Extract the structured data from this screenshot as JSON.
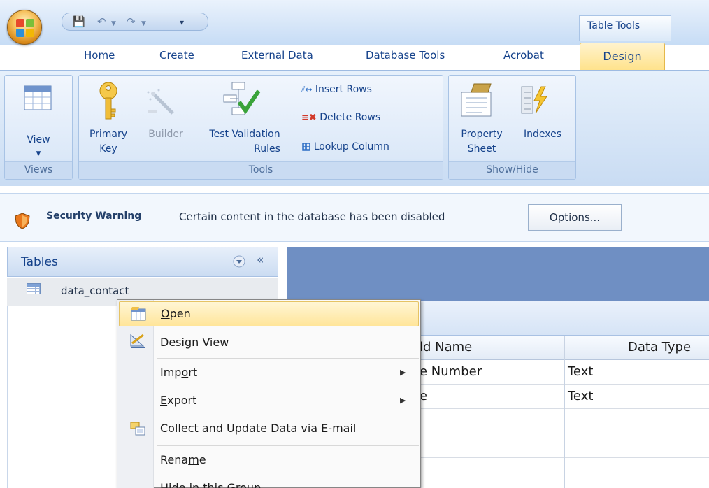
{
  "window": {
    "context_tab_group": "Table Tools"
  },
  "tabs": [
    "Home",
    "Create",
    "External Data",
    "Database Tools",
    "Acrobat"
  ],
  "active_tab": "Design",
  "ribbon": {
    "views": {
      "title": "Views",
      "view_label": "View"
    },
    "tools": {
      "title": "Tools",
      "primary_key_1": "Primary",
      "primary_key_2": "Key",
      "builder": "Builder",
      "test_validation_1": "Test Validation",
      "test_validation_2": "Rules",
      "insert_rows": "Insert Rows",
      "delete_rows": "Delete Rows",
      "lookup_column": "Lookup Column"
    },
    "show_hide": {
      "title": "Show/Hide",
      "property_sheet_1": "Property",
      "property_sheet_2": "Sheet",
      "indexes": "Indexes"
    }
  },
  "security": {
    "title": "Security Warning",
    "message": "Certain content in the database has been disabled",
    "options": "Options..."
  },
  "nav": {
    "header": "Tables",
    "collapse_glyph": "«",
    "item": "data_contact"
  },
  "design_grid": {
    "headers": [
      "ld Name",
      "Data Type"
    ],
    "rows": [
      [
        "e Number",
        "Text"
      ],
      [
        "e",
        "Text"
      ]
    ]
  },
  "context_menu": {
    "items": {
      "open_key": "O",
      "open_rest": "pen",
      "design_key": "D",
      "design_rest": "esign View",
      "import_pre": "Imp",
      "import_key": "o",
      "import_rest": "rt",
      "export_key": "E",
      "export_rest": "xport",
      "collect_pre": "Co",
      "collect_key": "l",
      "collect_rest": "lect and Update Data via E-mail",
      "rename_pre": "Rena",
      "rename_key": "m",
      "rename_rest": "e",
      "hide": "Hide in this Group"
    }
  }
}
